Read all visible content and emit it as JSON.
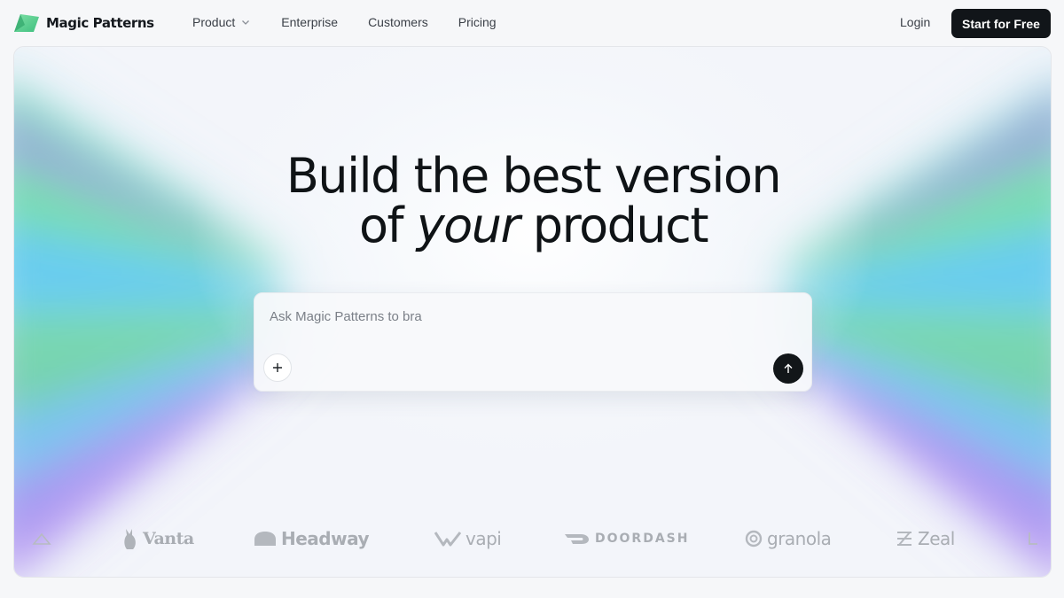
{
  "brand": {
    "name": "Magic Patterns",
    "logo": "magic-patterns-logo"
  },
  "nav": {
    "items": [
      {
        "label": "Product",
        "has_dropdown": true
      },
      {
        "label": "Enterprise"
      },
      {
        "label": "Customers"
      },
      {
        "label": "Pricing"
      }
    ],
    "login_label": "Login",
    "cta_label": "Start for Free"
  },
  "hero": {
    "headline_line1": "Build the best version",
    "headline_prefix": "of ",
    "headline_emphasis": "your",
    "headline_suffix": " product",
    "prompt": {
      "value": "Ask Magic Patterns to bra",
      "attach_icon": "plus-icon",
      "send_icon": "arrow-up-icon"
    }
  },
  "customers": [
    {
      "name": "Vanta",
      "icon": "vanta-logo"
    },
    {
      "name": "Headway",
      "icon": "headway-logo"
    },
    {
      "name": "vapi",
      "icon": "vapi-logo"
    },
    {
      "name": "DOORDASH",
      "icon": "doordash-logo"
    },
    {
      "name": "granola",
      "icon": "granola-logo"
    },
    {
      "name": "Zeal",
      "icon": "zeal-logo"
    }
  ],
  "colors": {
    "cta_background": "#111519",
    "headline": "#0f1316",
    "aurora_green": "#5fdc9e",
    "aurora_blue": "#5cc9ef",
    "aurora_purple": "#a98cf2"
  }
}
